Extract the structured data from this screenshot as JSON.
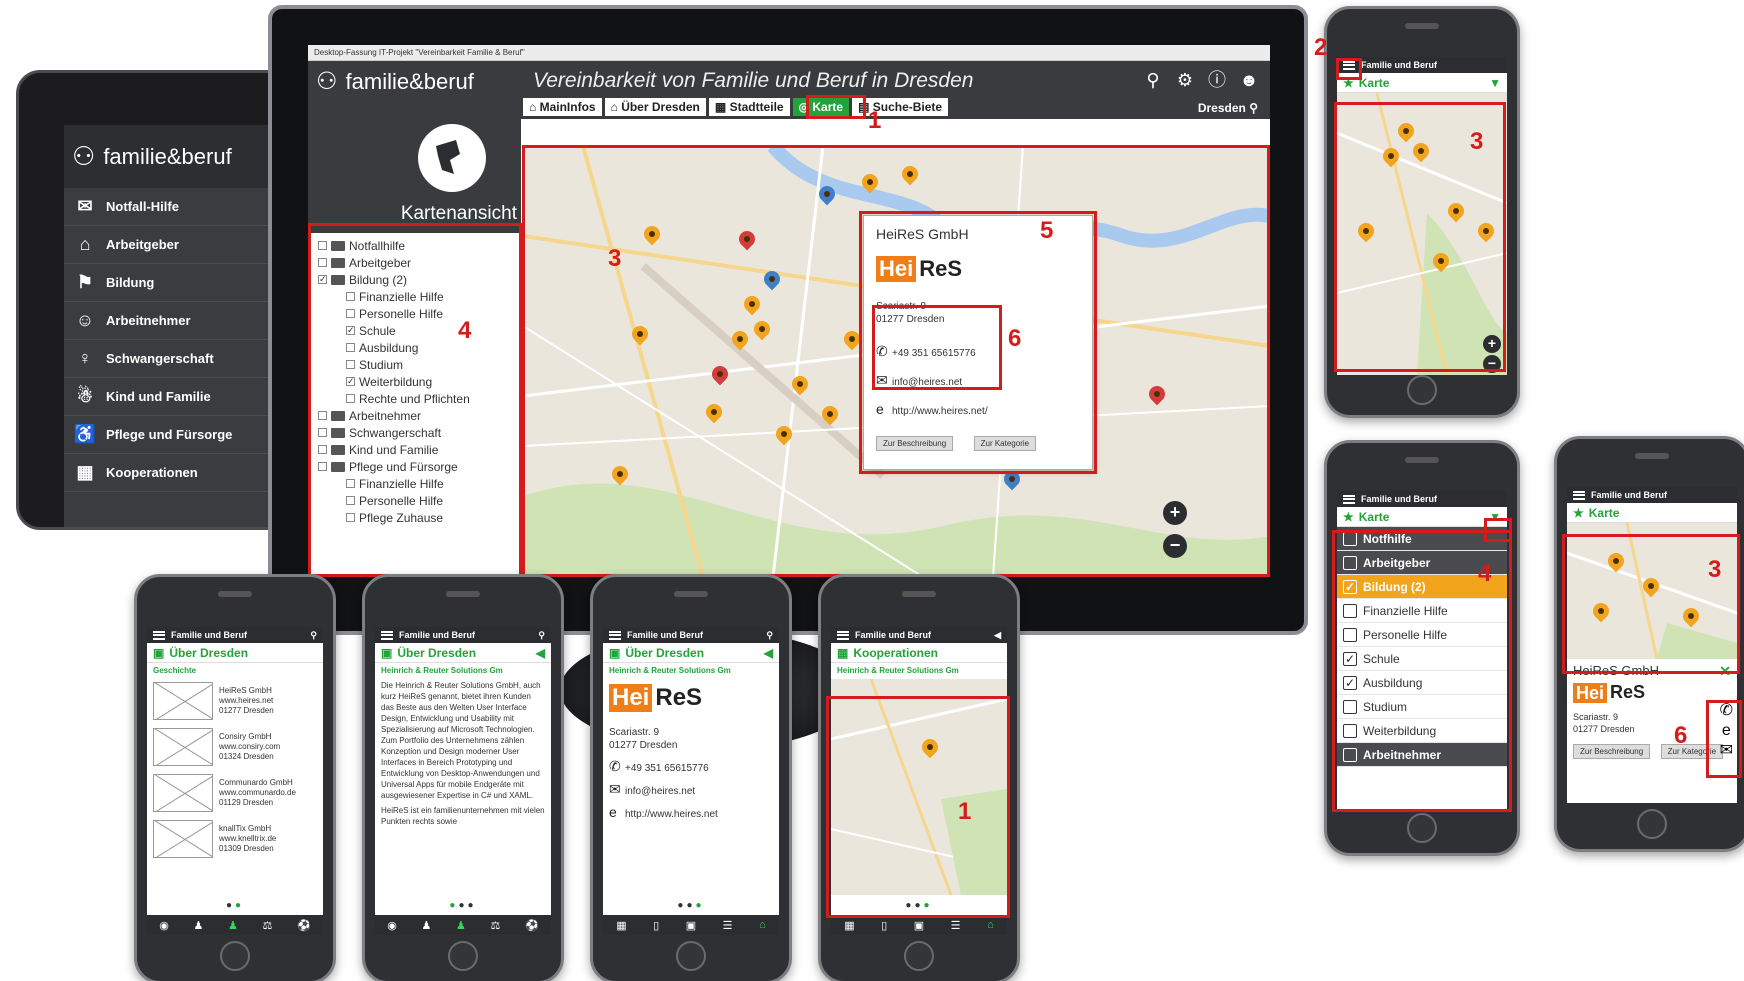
{
  "desktop": {
    "window_title": "Desktop-Fassung IT-Projekt \"Vereinbarkeit Familie & Beruf\"",
    "brand": "familie&beruf",
    "app_title": "Vereinbarkeit von Familie und Beruf in Dresden",
    "tabs": [
      {
        "label": "MainInfos",
        "icon": "home-icon"
      },
      {
        "label": "Über Dresden",
        "icon": "building-icon"
      },
      {
        "label": "Stadtteile",
        "icon": "grid-icon"
      },
      {
        "label": "Karte",
        "icon": "globe-icon",
        "active": true
      },
      {
        "label": "Suche-Biete",
        "icon": "calendar-icon"
      }
    ],
    "city": "Dresden",
    "view_label": "Kartenansicht",
    "tree": [
      {
        "label": "Notfallhilfe",
        "level": 1,
        "checked": false
      },
      {
        "label": "Arbeitgeber",
        "level": 1,
        "checked": false
      },
      {
        "label": "Bildung (2)",
        "level": 1,
        "checked": true
      },
      {
        "label": "Finanzielle Hilfe",
        "level": 2,
        "checked": false
      },
      {
        "label": "Personelle Hilfe",
        "level": 2,
        "checked": false
      },
      {
        "label": "Schule",
        "level": 2,
        "checked": true
      },
      {
        "label": "Ausbildung",
        "level": 2,
        "checked": false
      },
      {
        "label": "Studium",
        "level": 2,
        "checked": false
      },
      {
        "label": "Weiterbildung",
        "level": 2,
        "checked": true
      },
      {
        "label": "Rechte und Pflichten",
        "level": 2,
        "checked": false
      },
      {
        "label": "Arbeitnehmer",
        "level": 1,
        "checked": false
      },
      {
        "label": "Schwangerschaft",
        "level": 1,
        "checked": false
      },
      {
        "label": "Kind und Familie",
        "level": 1,
        "checked": false
      },
      {
        "label": "Pflege und Fürsorge",
        "level": 1,
        "checked": false
      },
      {
        "label": "Finanzielle Hilfe",
        "level": 2,
        "checked": false
      },
      {
        "label": "Personelle Hilfe",
        "level": 2,
        "checked": false
      },
      {
        "label": "Pflege Zuhause",
        "level": 2,
        "checked": false
      }
    ],
    "popup": {
      "name": "HeiReS GmbH",
      "logo_a": "Hei",
      "logo_b": "ReS",
      "street": "Scariastr. 9",
      "city": "01277 Dresden",
      "phone": "+49 351 65615776",
      "email": "info@heires.net",
      "web": "http://www.heires.net/",
      "btn_desc": "Zur Beschreibung",
      "btn_cat": "Zur Kategorie"
    }
  },
  "tablet": {
    "brand": "familie&beruf",
    "menu": [
      {
        "label": "Notfall-Hilfe",
        "icon": "megaphone-icon"
      },
      {
        "label": "Arbeitgeber",
        "icon": "building-icon"
      },
      {
        "label": "Bildung",
        "icon": "graduation-cap-icon"
      },
      {
        "label": "Arbeitnehmer",
        "icon": "group-icon"
      },
      {
        "label": "Schwangerschaft",
        "icon": "pregnant-icon"
      },
      {
        "label": "Kind und Familie",
        "icon": "family-icon"
      },
      {
        "label": "Pflege und Fürsorge",
        "icon": "wheelchair-icon"
      },
      {
        "label": "Kooperationen",
        "icon": "office-icon"
      }
    ]
  },
  "phone_bar_title": "Familie und Beruf",
  "phone_list": {
    "header": "Über Dresden",
    "sub": "Geschichte",
    "rows": [
      {
        "l1": "HeiReS GmbH",
        "l2": "www.heires.net",
        "l3": "01277 Dresden"
      },
      {
        "l1": "Consiry GmbH",
        "l2": "www.consiry.com",
        "l3": "01324 Dresden"
      },
      {
        "l1": "Communardo GmbH",
        "l2": "www.communardo.de",
        "l3": "01129 Dresden"
      },
      {
        "l1": "knallTix GmbH",
        "l2": "www.knelltrix.de",
        "l3": "01309 Dresden"
      }
    ]
  },
  "phone_text": {
    "header": "Über Dresden",
    "sub": "Heinrich & Reuter Solutions Gm",
    "body": "Die Heinrich & Reuter Solutions GmbH, auch kurz HeiReS genannt, bietet ihren Kunden das Beste aus den Welten User Interface Design, Entwicklung und Usability mit Spezialisierung auf Microsoft Technologien. Zum Portfolio des Unternehmens zählen Konzeption und Design moderner User Interfaces in Bereich Prototyping und Entwicklung von Desktop-Anwendungen und Universal Apps für mobile Endgeräte mit ausgewiesener Expertise in C# und XAML.",
    "body2": "HeiReS ist ein familienunternehmen mit vielen Punkten rechts sowie"
  },
  "phone_contact": {
    "header": "Über Dresden",
    "sub": "Heinrich & Reuter Solutions Gm",
    "logo_a": "Hei",
    "logo_b": "ReS",
    "street": "Scariastr. 9",
    "city": "01277 Dresden",
    "phone": "+49 351 65615776",
    "email": "info@heires.net",
    "web": "http://www.heires.net"
  },
  "phone_coop": {
    "header": "Kooperationen",
    "sub": "Heinrich & Reuter Solutions Gm"
  },
  "phone_map_top": {
    "header": "Karte"
  },
  "phone_filter": {
    "header": "Karte",
    "items": [
      {
        "label": "Notfhilfe",
        "style": "dark",
        "checked": false
      },
      {
        "label": "Arbeitgeber",
        "style": "dark",
        "checked": false
      },
      {
        "label": "Bildung (2)",
        "style": "hl",
        "checked": true
      },
      {
        "label": "Finanzielle Hilfe",
        "style": "",
        "checked": false
      },
      {
        "label": "Personelle Hilfe",
        "style": "",
        "checked": false
      },
      {
        "label": "Schule",
        "style": "",
        "checked": true
      },
      {
        "label": "Ausbildung",
        "style": "",
        "checked": true
      },
      {
        "label": "Studium",
        "style": "",
        "checked": false
      },
      {
        "label": "Weiterbildung",
        "style": "",
        "checked": false
      },
      {
        "label": "Arbeitnehmer",
        "style": "dark",
        "checked": false
      }
    ]
  },
  "phone_detail": {
    "header": "Karte",
    "name": "HeiReS GmbH",
    "logo_a": "Hei",
    "logo_b": "ReS",
    "street": "Scariastr. 9",
    "city": "01277 Dresden",
    "btn_desc": "Zur Beschreibung",
    "btn_cat": "Zur Kategorie"
  },
  "annotations": [
    "1",
    "2",
    "3",
    "4",
    "5",
    "6"
  ],
  "colors": {
    "accent_green": "#23a33a",
    "accent_orange": "#f2a41c",
    "annotation_red": "#d51b1b",
    "chrome_dark": "#3a3b3e"
  }
}
